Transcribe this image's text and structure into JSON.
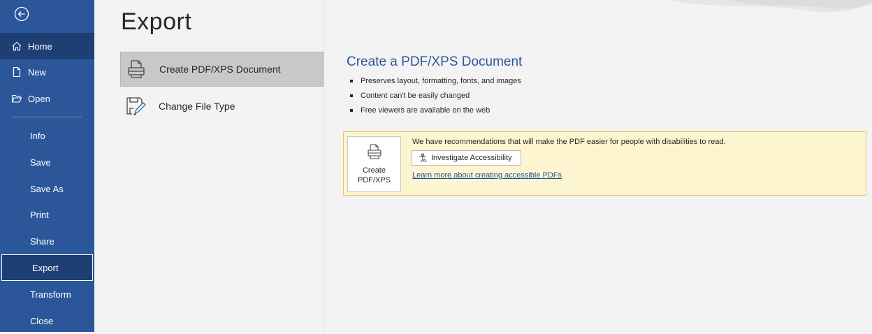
{
  "sidebar": {
    "back_icon": "back-arrow-icon",
    "items": [
      {
        "label": "Home",
        "icon": "home-icon"
      },
      {
        "label": "New",
        "icon": "new-document-icon"
      },
      {
        "label": "Open",
        "icon": "folder-open-icon"
      },
      {
        "label": "Info"
      },
      {
        "label": "Save"
      },
      {
        "label": "Save As"
      },
      {
        "label": "Print"
      },
      {
        "label": "Share"
      },
      {
        "label": "Export"
      },
      {
        "label": "Transform"
      },
      {
        "label": "Close"
      }
    ],
    "selected": "Export"
  },
  "main": {
    "title": "Export",
    "options": [
      {
        "label": "Create PDF/XPS Document",
        "icon": "pdf-document-icon",
        "selected": true
      },
      {
        "label": "Change File Type",
        "icon": "change-file-type-icon",
        "selected": false
      }
    ]
  },
  "detail": {
    "title": "Create a PDF/XPS Document",
    "bullets": [
      "Preserves layout, formatting, fonts, and images",
      "Content can't be easily changed",
      "Free viewers are available on the web"
    ],
    "banner": {
      "button_label": "Create\nPDF/XPS",
      "message": "We have recommendations that will make the PDF easier for people with disabilities to read.",
      "investigate_label": "Investigate Accessibility",
      "link_text": "Learn more about creating accessible PDFs"
    }
  },
  "colors": {
    "sidebar": "#2b579a",
    "sidebar_selected": "#1e3f73",
    "accent_title": "#2b579a",
    "banner_bg": "#fdf5d0",
    "banner_border": "#e7c66c"
  }
}
